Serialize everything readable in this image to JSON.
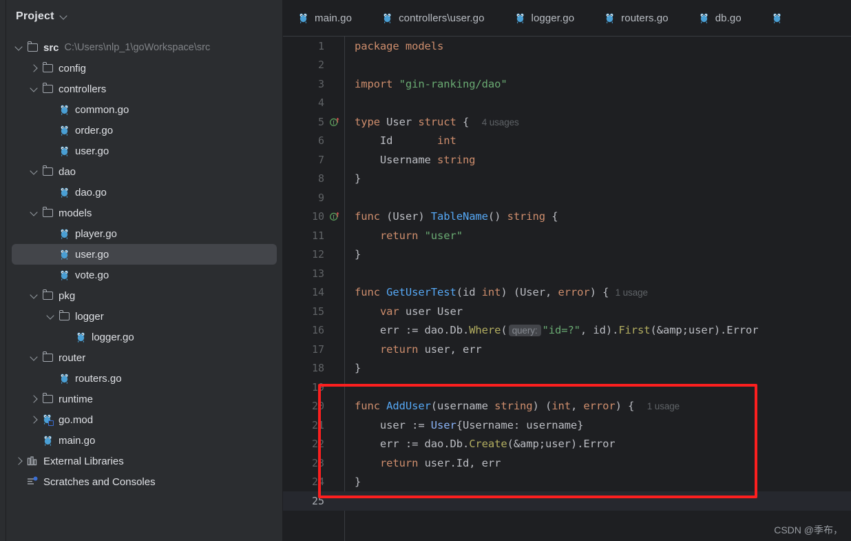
{
  "sidebar": {
    "header": {
      "title": "Project",
      "dropdown_icon": "chevron-down-icon"
    },
    "tree": [
      {
        "label": "src",
        "sub": "C:\\Users\\nlp_1\\goWorkspace\\src",
        "icon": "folder-icon",
        "twisty": "chevron-down-icon",
        "indent": 0,
        "bold": true,
        "selected": false
      },
      {
        "label": "config",
        "sub": "",
        "icon": "folder-icon",
        "twisty": "chevron-right-icon",
        "indent": 1,
        "bold": false,
        "selected": false
      },
      {
        "label": "controllers",
        "sub": "",
        "icon": "folder-icon",
        "twisty": "chevron-down-icon",
        "indent": 1,
        "bold": false,
        "selected": false
      },
      {
        "label": "common.go",
        "sub": "",
        "icon": "go-file-icon",
        "twisty": "",
        "indent": 2,
        "bold": false,
        "selected": false
      },
      {
        "label": "order.go",
        "sub": "",
        "icon": "go-file-icon",
        "twisty": "",
        "indent": 2,
        "bold": false,
        "selected": false
      },
      {
        "label": "user.go",
        "sub": "",
        "icon": "go-file-icon",
        "twisty": "",
        "indent": 2,
        "bold": false,
        "selected": false
      },
      {
        "label": "dao",
        "sub": "",
        "icon": "folder-icon",
        "twisty": "chevron-down-icon",
        "indent": 1,
        "bold": false,
        "selected": false
      },
      {
        "label": "dao.go",
        "sub": "",
        "icon": "go-file-icon",
        "twisty": "",
        "indent": 2,
        "bold": false,
        "selected": false
      },
      {
        "label": "models",
        "sub": "",
        "icon": "folder-icon",
        "twisty": "chevron-down-icon",
        "indent": 1,
        "bold": false,
        "selected": false
      },
      {
        "label": "player.go",
        "sub": "",
        "icon": "go-file-icon",
        "twisty": "",
        "indent": 2,
        "bold": false,
        "selected": false
      },
      {
        "label": "user.go",
        "sub": "",
        "icon": "go-file-icon",
        "twisty": "",
        "indent": 2,
        "bold": false,
        "selected": true
      },
      {
        "label": "vote.go",
        "sub": "",
        "icon": "go-file-icon",
        "twisty": "",
        "indent": 2,
        "bold": false,
        "selected": false
      },
      {
        "label": "pkg",
        "sub": "",
        "icon": "folder-icon",
        "twisty": "chevron-down-icon",
        "indent": 1,
        "bold": false,
        "selected": false
      },
      {
        "label": "logger",
        "sub": "",
        "icon": "folder-icon",
        "twisty": "chevron-down-icon",
        "indent": 2,
        "bold": false,
        "selected": false
      },
      {
        "label": "logger.go",
        "sub": "",
        "icon": "go-file-icon",
        "twisty": "",
        "indent": 3,
        "bold": false,
        "selected": false
      },
      {
        "label": "router",
        "sub": "",
        "icon": "folder-icon",
        "twisty": "chevron-down-icon",
        "indent": 1,
        "bold": false,
        "selected": false
      },
      {
        "label": "routers.go",
        "sub": "",
        "icon": "go-file-icon",
        "twisty": "",
        "indent": 2,
        "bold": false,
        "selected": false
      },
      {
        "label": "runtime",
        "sub": "",
        "icon": "folder-icon",
        "twisty": "chevron-right-icon",
        "indent": 1,
        "bold": false,
        "selected": false
      },
      {
        "label": "go.mod",
        "sub": "",
        "icon": "go-module-icon",
        "twisty": "chevron-right-icon",
        "indent": 1,
        "bold": false,
        "selected": false
      },
      {
        "label": "main.go",
        "sub": "",
        "icon": "go-file-icon",
        "twisty": "",
        "indent": 1,
        "bold": false,
        "selected": false
      },
      {
        "label": "External Libraries",
        "sub": "",
        "icon": "library-icon",
        "twisty": "chevron-right-icon",
        "indent": 0,
        "bold": false,
        "selected": false
      },
      {
        "label": "Scratches and Consoles",
        "sub": "",
        "icon": "scratches-icon",
        "twisty": "",
        "indent": 0,
        "bold": false,
        "selected": false
      }
    ]
  },
  "editor": {
    "tabs": [
      {
        "label": "main.go",
        "icon": "go-file-icon",
        "active": false
      },
      {
        "label": "controllers\\user.go",
        "icon": "go-file-icon",
        "active": false
      },
      {
        "label": "logger.go",
        "icon": "go-file-icon",
        "active": false
      },
      {
        "label": "routers.go",
        "icon": "go-file-icon",
        "active": false
      },
      {
        "label": "db.go",
        "icon": "go-file-icon",
        "active": false
      },
      {
        "label": "",
        "icon": "go-file-icon",
        "active": false
      }
    ],
    "lines": [
      {
        "n": "1",
        "gutter": "",
        "current": false
      },
      {
        "n": "2",
        "gutter": "",
        "current": false
      },
      {
        "n": "3",
        "gutter": "",
        "current": false
      },
      {
        "n": "4",
        "gutter": "",
        "current": false
      },
      {
        "n": "5",
        "gutter": "implementation-icon",
        "current": false
      },
      {
        "n": "6",
        "gutter": "",
        "current": false
      },
      {
        "n": "7",
        "gutter": "",
        "current": false
      },
      {
        "n": "8",
        "gutter": "",
        "current": false
      },
      {
        "n": "9",
        "gutter": "",
        "current": false
      },
      {
        "n": "10",
        "gutter": "implementation-icon",
        "current": false
      },
      {
        "n": "11",
        "gutter": "",
        "current": false
      },
      {
        "n": "12",
        "gutter": "",
        "current": false
      },
      {
        "n": "13",
        "gutter": "",
        "current": false
      },
      {
        "n": "14",
        "gutter": "",
        "current": false
      },
      {
        "n": "15",
        "gutter": "",
        "current": false
      },
      {
        "n": "16",
        "gutter": "",
        "current": false
      },
      {
        "n": "17",
        "gutter": "",
        "current": false
      },
      {
        "n": "18",
        "gutter": "",
        "current": false
      },
      {
        "n": "19",
        "gutter": "",
        "current": false
      },
      {
        "n": "20",
        "gutter": "",
        "current": false
      },
      {
        "n": "21",
        "gutter": "",
        "current": false
      },
      {
        "n": "22",
        "gutter": "",
        "current": false
      },
      {
        "n": "23",
        "gutter": "",
        "current": false
      },
      {
        "n": "24",
        "gutter": "",
        "current": false
      },
      {
        "n": "25",
        "gutter": "",
        "current": true
      }
    ],
    "code_text": [
      "package models",
      "",
      "import \"gin-ranking/dao\"",
      "",
      "type User struct {   4 usages",
      "    Id       int",
      "    Username string",
      "}",
      "",
      "func (User) TableName() string {",
      "    return \"user\"",
      "}",
      "",
      "func GetUserTest(id int) (User, error) {  1 usage",
      "    var user User",
      "    err := dao.Db.Where( query: \"id=?\", id).First(&user).Error",
      "    return user, err",
      "}",
      "",
      "func AddUser(username string) (int, error) {  1 usage",
      "    user := User{Username: username}",
      "    err := dao.Db.Create(&user).Error",
      "    return user.Id, err",
      "}",
      ""
    ],
    "inlay_hints": {
      "usages_4": "4 usages",
      "usage_1a": "1 usage",
      "usage_1b": "1 usage",
      "param_query": "query:"
    },
    "annotation": {
      "type": "red-rectangle-highlight",
      "color": "#fc1f1f",
      "covers_lines": "20-24"
    }
  },
  "watermark": {
    "text": "CSDN @季布，"
  },
  "colors": {
    "sidebar_bg": "#2b2d30",
    "editor_bg": "#1e1f22",
    "selection_bg": "#43454a",
    "accent_red": "#fc1f1f",
    "keyword": "#cf8e6d",
    "string": "#6aab73",
    "function": "#56a8f5",
    "type": "#8ab4f8",
    "method": "#b3ae60",
    "plain": "#bcbec4",
    "hint": "#5f6367"
  }
}
